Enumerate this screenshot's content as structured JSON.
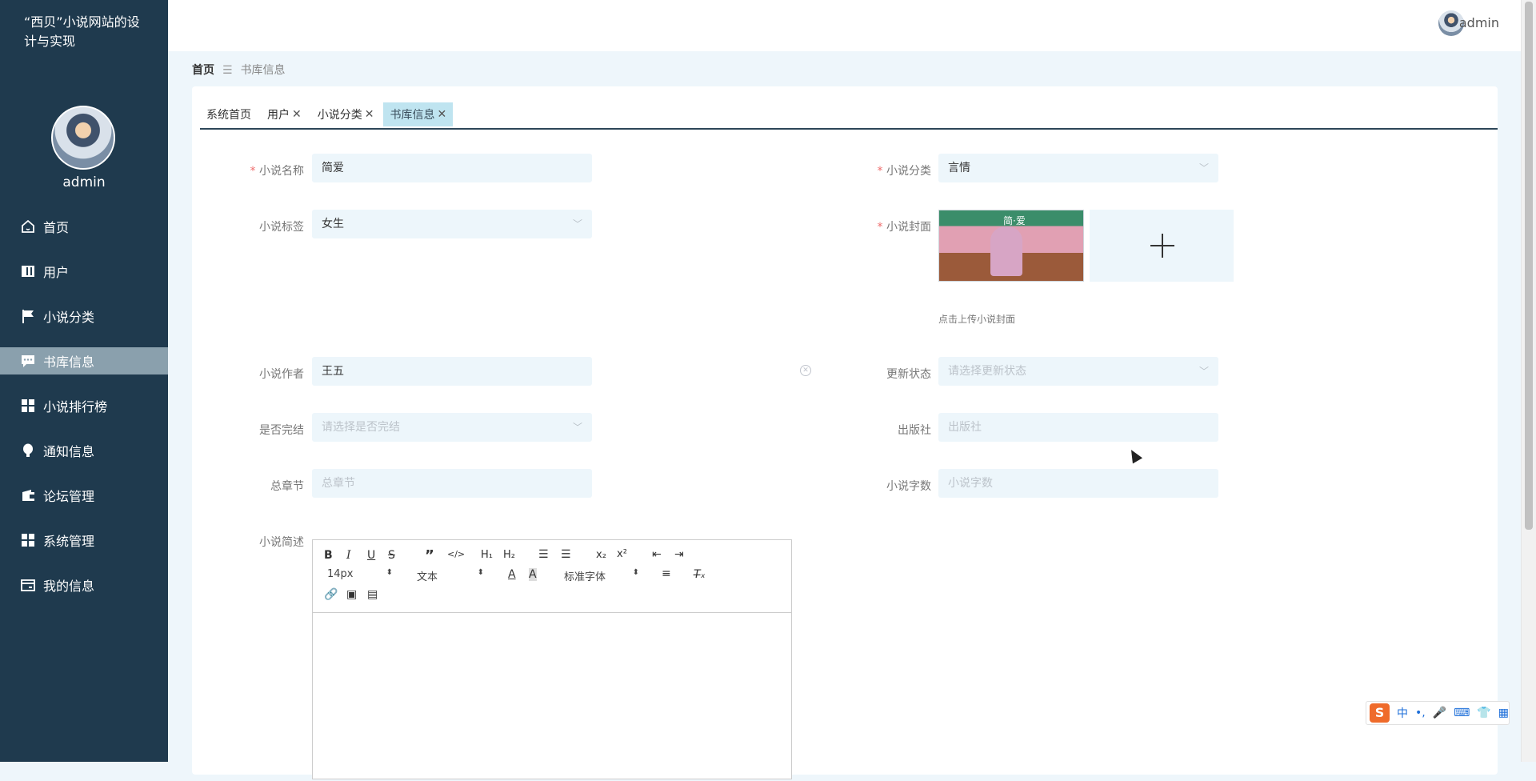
{
  "site_title": "“西贝”小说网站的设计与实现",
  "user": {
    "name": "admin"
  },
  "menu": [
    {
      "label": "首页",
      "icon": "home-icon"
    },
    {
      "label": "用户",
      "icon": "book-icon"
    },
    {
      "label": "小说分类",
      "icon": "flag-icon"
    },
    {
      "label": "书库信息",
      "icon": "chat-icon",
      "active": true
    },
    {
      "label": "小说排行榜",
      "icon": "grid-icon"
    },
    {
      "label": "通知信息",
      "icon": "bulb-icon"
    },
    {
      "label": "论坛管理",
      "icon": "wallet-icon"
    },
    {
      "label": "系统管理",
      "icon": "grid-icon"
    },
    {
      "label": "我的信息",
      "icon": "card-icon"
    }
  ],
  "breadcrumb": {
    "home": "首页",
    "separator": "☰",
    "current": "书库信息"
  },
  "tabs": [
    {
      "label": "系统首页",
      "closable": false
    },
    {
      "label": "用户",
      "closable": true
    },
    {
      "label": "小说分类",
      "closable": true
    },
    {
      "label": "书库信息",
      "closable": true,
      "active": true
    }
  ],
  "form": {
    "name": {
      "label": "小说名称",
      "value": "简爱",
      "required": true
    },
    "category": {
      "label": "小说分类",
      "value": "言情",
      "required": true
    },
    "tag": {
      "label": "小说标签",
      "value": "女生"
    },
    "cover": {
      "label": "小说封面",
      "required": true,
      "hint": "点击上传小说封面",
      "cover_title": "简·爱"
    },
    "author": {
      "label": "小说作者",
      "value": "王五"
    },
    "update_status": {
      "label": "更新状态",
      "placeholder": "请选择更新状态"
    },
    "finished": {
      "label": "是否完结",
      "placeholder": "请选择是否完结"
    },
    "publisher": {
      "label": "出版社",
      "placeholder": "出版社"
    },
    "chapters": {
      "label": "总章节",
      "placeholder": "总章节"
    },
    "word_count": {
      "label": "小说字数",
      "placeholder": "小说字数"
    },
    "summary": {
      "label": "小说简述"
    }
  },
  "editor_toolbar": {
    "size": "14px",
    "paragraph": "文本",
    "font": "标准字体"
  },
  "ime": {
    "mode": "中"
  },
  "colors": {
    "sidebar_bg": "#1f3a4e",
    "active_menu": "#8aa0ad",
    "tab_active": "#bfe4f0",
    "required": "#ef6e6e"
  }
}
